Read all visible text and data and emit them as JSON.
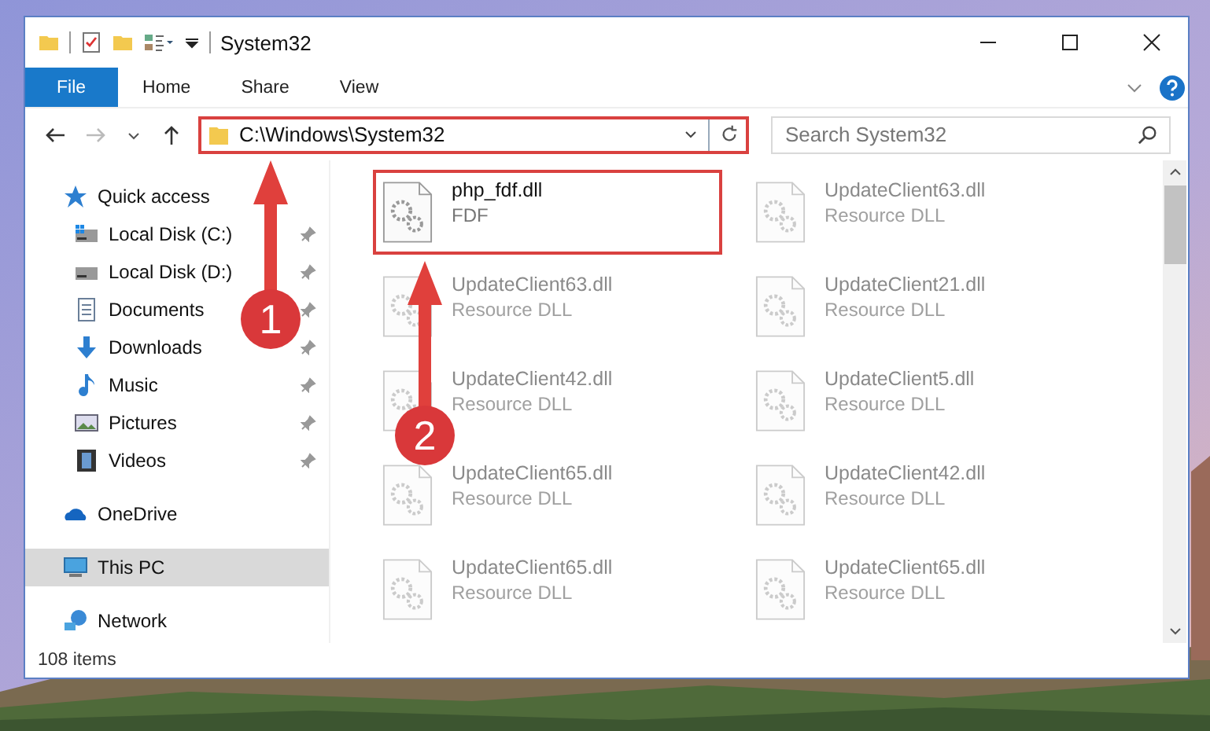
{
  "window": {
    "title": "System32"
  },
  "ribbon_tabs": [
    {
      "label": "File",
      "selected": true
    },
    {
      "label": "Home",
      "selected": false
    },
    {
      "label": "Share",
      "selected": false
    },
    {
      "label": "View",
      "selected": false
    }
  ],
  "address_bar": {
    "path": "C:\\Windows\\System32",
    "highlighted": true
  },
  "search": {
    "placeholder": "Search System32"
  },
  "sidebar": {
    "items": [
      {
        "label": "Quick access",
        "selected": false,
        "children": [
          {
            "label": "Local Disk (C:)",
            "pinned": true
          },
          {
            "label": "Local Disk (D:)",
            "pinned": true
          },
          {
            "label": "Documents",
            "pinned": true
          },
          {
            "label": "Downloads",
            "pinned": true
          },
          {
            "label": "Music",
            "pinned": true
          },
          {
            "label": "Pictures",
            "pinned": true
          },
          {
            "label": "Videos",
            "pinned": true
          }
        ]
      },
      {
        "label": "OneDrive",
        "selected": false
      },
      {
        "label": "This PC",
        "selected": true
      },
      {
        "label": "Network",
        "selected": false
      }
    ]
  },
  "files": [
    {
      "name": "php_fdf.dll",
      "type": "FDF",
      "faded": false,
      "highlighted": true
    },
    {
      "name": "UpdateClient63.dll",
      "type": "Resource DLL",
      "faded": true,
      "highlighted": false
    },
    {
      "name": "UpdateClient63.dll",
      "type": "Resource DLL",
      "faded": true,
      "highlighted": false
    },
    {
      "name": "UpdateClient21.dll",
      "type": "Resource DLL",
      "faded": true,
      "highlighted": false
    },
    {
      "name": "UpdateClient42.dll",
      "type": "Resource DLL",
      "faded": true,
      "highlighted": false
    },
    {
      "name": "UpdateClient5.dll",
      "type": "Resource DLL",
      "faded": true,
      "highlighted": false
    },
    {
      "name": "UpdateClient65.dll",
      "type": "Resource DLL",
      "faded": true,
      "highlighted": false
    },
    {
      "name": "UpdateClient42.dll",
      "type": "Resource DLL",
      "faded": true,
      "highlighted": false
    },
    {
      "name": "UpdateClient65.dll",
      "type": "Resource DLL",
      "faded": true,
      "highlighted": false
    },
    {
      "name": "UpdateClient65.dll",
      "type": "Resource DLL",
      "faded": true,
      "highlighted": false
    }
  ],
  "status_bar": {
    "count": "108 items"
  },
  "callouts": [
    {
      "number": "1"
    },
    {
      "number": "2"
    }
  ]
}
